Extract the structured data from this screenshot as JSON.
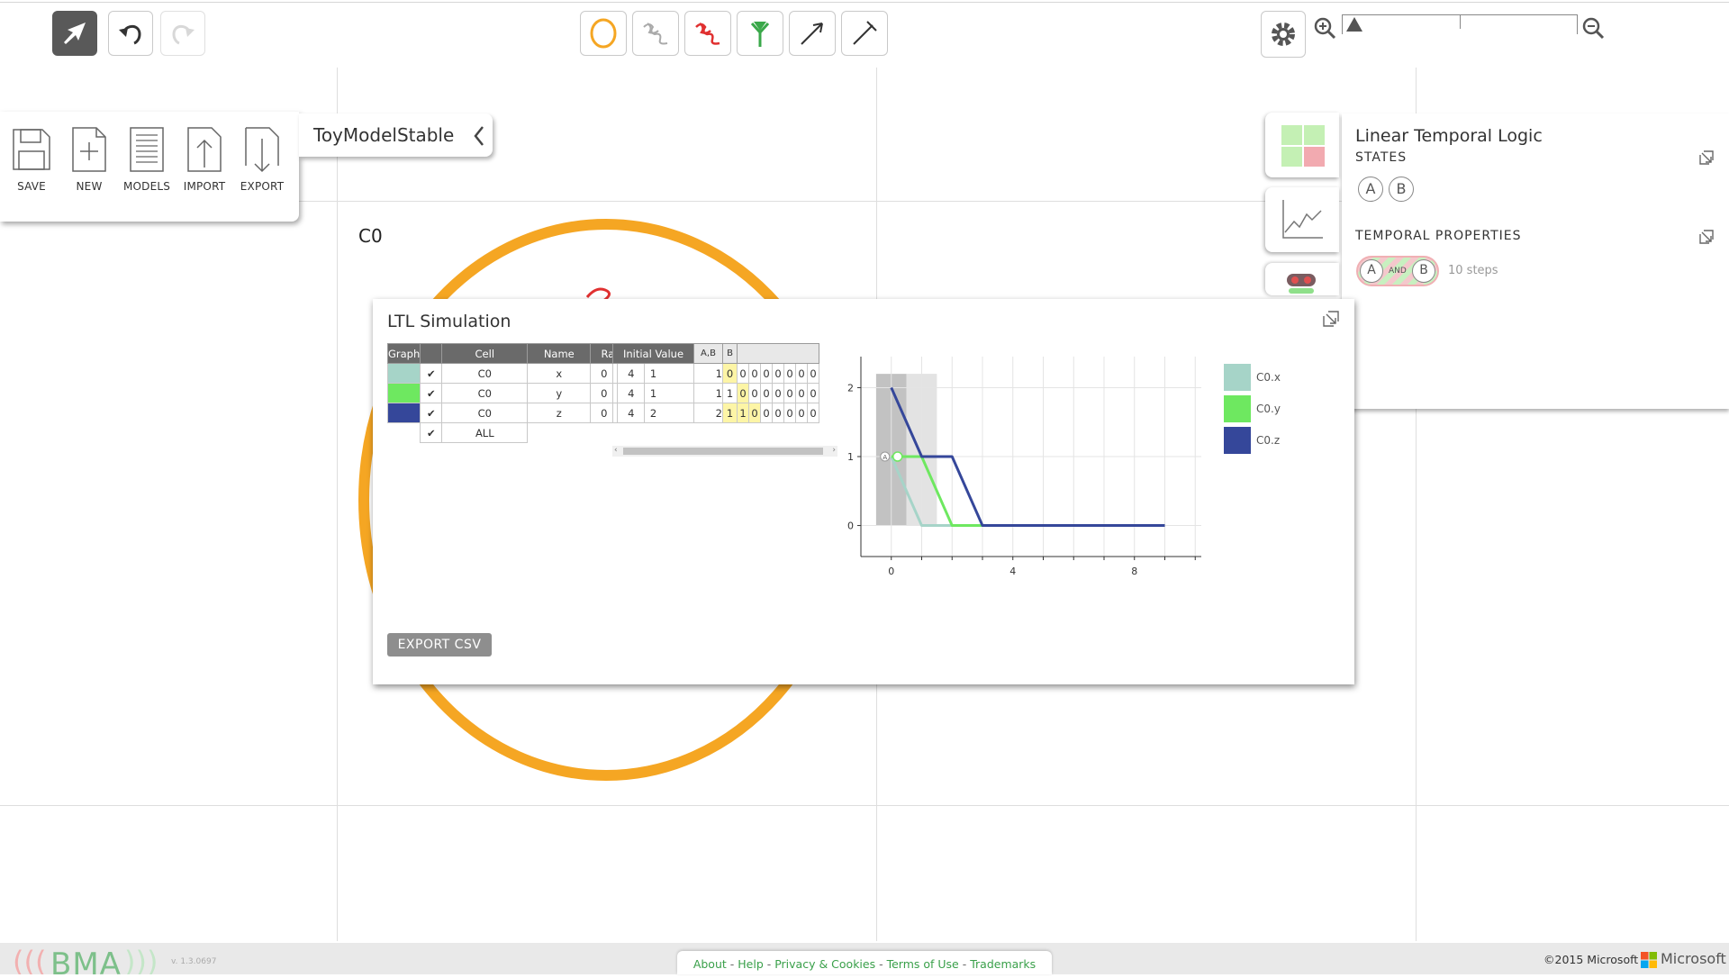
{
  "toolbar": {
    "left_tools": [
      {
        "icon": "pointer-arrow-icon",
        "active": true
      },
      {
        "icon": "undo-icon",
        "active": false
      },
      {
        "icon": "redo-icon",
        "active": false
      }
    ],
    "element_tools": [
      {
        "icon": "cell-container-icon",
        "color": "#f5a623"
      },
      {
        "icon": "constant-variable-icon",
        "color": "#aaaaaa"
      },
      {
        "icon": "variable-icon",
        "color": "#e03030"
      },
      {
        "icon": "receptor-icon",
        "color": "#3aa84a"
      },
      {
        "icon": "activator-arrow-icon",
        "color": "#333333"
      },
      {
        "icon": "inhibitor-arrow-icon",
        "color": "#333333"
      }
    ],
    "settings_icon": "gear-icon",
    "zoom": {
      "level": 0.02,
      "zoom_in_icon": "zoom-in-icon",
      "zoom_out_icon": "zoom-out-icon"
    }
  },
  "file_menu": {
    "items": [
      {
        "label": "SAVE",
        "icon": "save-icon"
      },
      {
        "label": "NEW",
        "icon": "new-file-icon"
      },
      {
        "label": "MODELS",
        "icon": "models-list-icon"
      },
      {
        "label": "IMPORT",
        "icon": "import-icon"
      },
      {
        "label": "EXPORT",
        "icon": "export-icon"
      }
    ],
    "model_name": "ToyModelStable",
    "collapse_icon": "chevron-left-icon"
  },
  "canvas": {
    "cell_label": "C0",
    "cell_color": "#f5a623"
  },
  "ltl_panel": {
    "title": "Linear Temporal Logic",
    "states_heading": "STATES",
    "states": [
      "A",
      "B"
    ],
    "temporal_heading": "TEMPORAL PROPERTIES",
    "formula": {
      "left": "A",
      "op": "AND",
      "right": "B"
    },
    "steps": "10 steps"
  },
  "simulation": {
    "title": "LTL Simulation",
    "headers": {
      "graph": "Graph",
      "cell": "Cell",
      "name": "Name",
      "range": "Range",
      "initial": "Initial Value",
      "state_ab": "A,B",
      "state_b": "B"
    },
    "rows": [
      {
        "color": "#a6d4c8",
        "checked": true,
        "cell": "C0",
        "name": "x",
        "min": "0",
        "max": "4",
        "initial": "1",
        "steps": [
          "1",
          "0",
          "0",
          "0",
          "0",
          "0",
          "0",
          "0",
          "0"
        ],
        "highlight": [
          1
        ]
      },
      {
        "color": "#6ee860",
        "checked": true,
        "cell": "C0",
        "name": "y",
        "min": "0",
        "max": "4",
        "initial": "1",
        "steps": [
          "1",
          "1",
          "0",
          "0",
          "0",
          "0",
          "0",
          "0",
          "0"
        ],
        "highlight": [
          2
        ]
      },
      {
        "color": "#35479a",
        "checked": true,
        "cell": "C0",
        "name": "z",
        "min": "0",
        "max": "4",
        "initial": "2",
        "steps": [
          "2",
          "1",
          "1",
          "0",
          "0",
          "0",
          "0",
          "0",
          "0"
        ],
        "highlight": [
          1,
          2,
          3
        ]
      }
    ],
    "all_label": "ALL",
    "export_label": "EXPORT CSV",
    "expand_icon": "expand-icon"
  },
  "chart_data": {
    "type": "line",
    "x": [
      0,
      1,
      2,
      3,
      4,
      5,
      6,
      7,
      8,
      9
    ],
    "series": [
      {
        "name": "C0.x",
        "color": "#a6d4c8",
        "values": [
          1,
          0,
          0,
          0,
          0,
          0,
          0,
          0,
          0,
          0
        ]
      },
      {
        "name": "C0.y",
        "color": "#6ee860",
        "values": [
          1,
          1,
          0,
          0,
          0,
          0,
          0,
          0,
          0,
          0
        ]
      },
      {
        "name": "C0.z",
        "color": "#35479a",
        "values": [
          2,
          1,
          1,
          0,
          0,
          0,
          0,
          0,
          0,
          0
        ]
      }
    ],
    "xlim": [
      -1,
      10.2
    ],
    "ylim": [
      -0.45,
      2.45
    ],
    "x_ticks": [
      "0",
      "4",
      "8"
    ],
    "y_ticks": [
      "0",
      "1",
      "2"
    ],
    "highlight_x": [
      [
        -0.5,
        0.5
      ],
      [
        0.5,
        1.5
      ]
    ],
    "state_marker": {
      "label": "A",
      "x": 0,
      "y": 1
    },
    "grid": true,
    "legend": "right"
  },
  "footer": {
    "brand": "BMA",
    "version": "v. 1.3.0697",
    "links": [
      "About",
      "Help",
      "Privacy & Cookies",
      "Terms of Use",
      "Trademarks"
    ],
    "copyright": "©2015 Microsoft",
    "company": "Microsoft"
  }
}
